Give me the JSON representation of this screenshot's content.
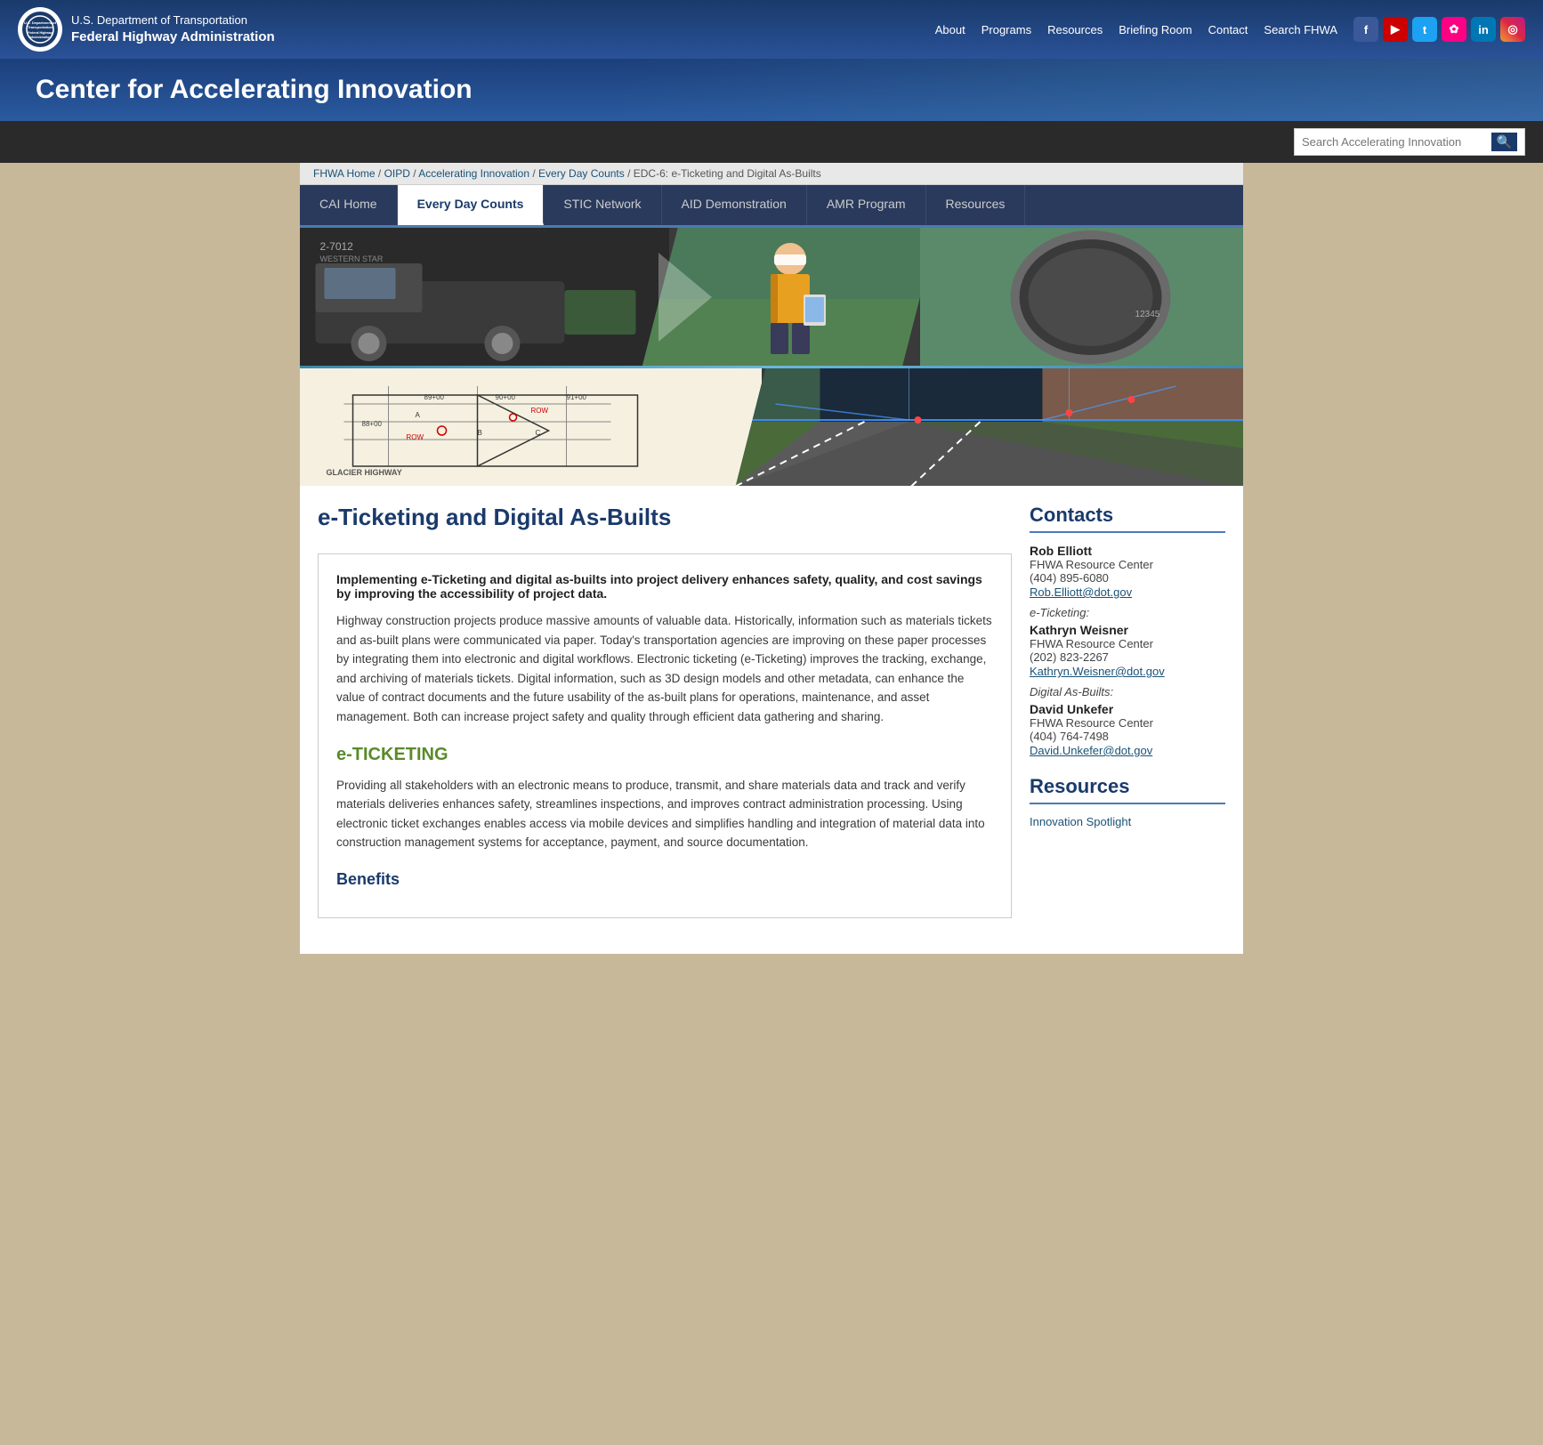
{
  "site": {
    "agency": "U.S. Department of Transportation",
    "agency_sub": "Federal Highway Administration",
    "banner_title": "Center for Accelerating Innovation"
  },
  "top_nav": {
    "links": [
      {
        "label": "About",
        "url": "#"
      },
      {
        "label": "Programs",
        "url": "#"
      },
      {
        "label": "Resources",
        "url": "#"
      },
      {
        "label": "Briefing Room",
        "url": "#"
      },
      {
        "label": "Contact",
        "url": "#"
      },
      {
        "label": "Search FHWA",
        "url": "#"
      }
    ]
  },
  "search": {
    "placeholder": "Search Accelerating Innovation",
    "button_label": "🔍"
  },
  "breadcrumb": {
    "items": [
      {
        "label": "FHWA Home",
        "url": "#"
      },
      {
        "label": "OIPD",
        "url": "#"
      },
      {
        "label": "Accelerating Innovation",
        "url": "#"
      },
      {
        "label": "Every Day Counts",
        "url": "#"
      },
      {
        "label": "EDC-6: e-Ticketing and Digital As-Builts",
        "url": "#"
      }
    ]
  },
  "tabs": [
    {
      "label": "CAI Home",
      "active": false,
      "id": "cai-home"
    },
    {
      "label": "Every Day Counts",
      "active": true,
      "id": "every-day-counts"
    },
    {
      "label": "STIC Network",
      "active": false,
      "id": "stic-network"
    },
    {
      "label": "AID Demonstration",
      "active": false,
      "id": "aid-demonstration"
    },
    {
      "label": "AMR Program",
      "active": false,
      "id": "amr-program"
    },
    {
      "label": "Resources",
      "active": false,
      "id": "resources"
    }
  ],
  "page": {
    "title": "e-Ticketing and Digital As-Builts",
    "intro_bold": "Implementing e-Ticketing and digital as-builts into project delivery enhances safety, quality, and cost savings by improving the accessibility of project data.",
    "intro_body": "Highway construction projects produce massive amounts of valuable data. Historically, information such as materials tickets and as-built plans were communicated via paper. Today's transportation agencies are improving on these paper processes by integrating them into electronic and digital workflows. Electronic ticketing (e-Ticketing) improves the tracking, exchange, and archiving of materials tickets. Digital information, such as 3D design models and other metadata, can enhance the value of contract documents and the future usability of the as-built plans for operations, maintenance, and asset management. Both can increase project safety and quality through efficient data gathering and sharing.",
    "section1_heading": "e-TICKETING",
    "section1_body": "Providing all stakeholders with an electronic means to produce, transmit, and share materials data and track and verify materials deliveries enhances safety, streamlines inspections, and improves contract administration processing. Using electronic ticket exchanges enables access via mobile devices and simplifies handling and integration of material data into construction management systems for acceptance, payment, and source documentation.",
    "section2_heading": "Benefits"
  },
  "contacts": {
    "title": "Contacts",
    "contacts_list": [
      {
        "name": "Rob Elliott",
        "org": "FHWA Resource Center",
        "phone": "(404) 895-6080",
        "email": "Rob.Elliott@dot.gov",
        "label": null
      }
    ],
    "eticket_label": "e-Ticketing:",
    "eticket_contact": {
      "name": "Kathryn Weisner",
      "org": "FHWA Resource Center",
      "phone": "(202) 823-2267",
      "email": "Kathryn.Weisner@dot.gov"
    },
    "digital_label": "Digital As-Builts:",
    "digital_contact": {
      "name": "David Unkefer",
      "org": "FHWA Resource Center",
      "phone": "(404) 764-7498",
      "email": "David.Unkefer@dot.gov"
    }
  },
  "resources": {
    "title": "Resources",
    "link_label": "Innovation Spotlight"
  }
}
